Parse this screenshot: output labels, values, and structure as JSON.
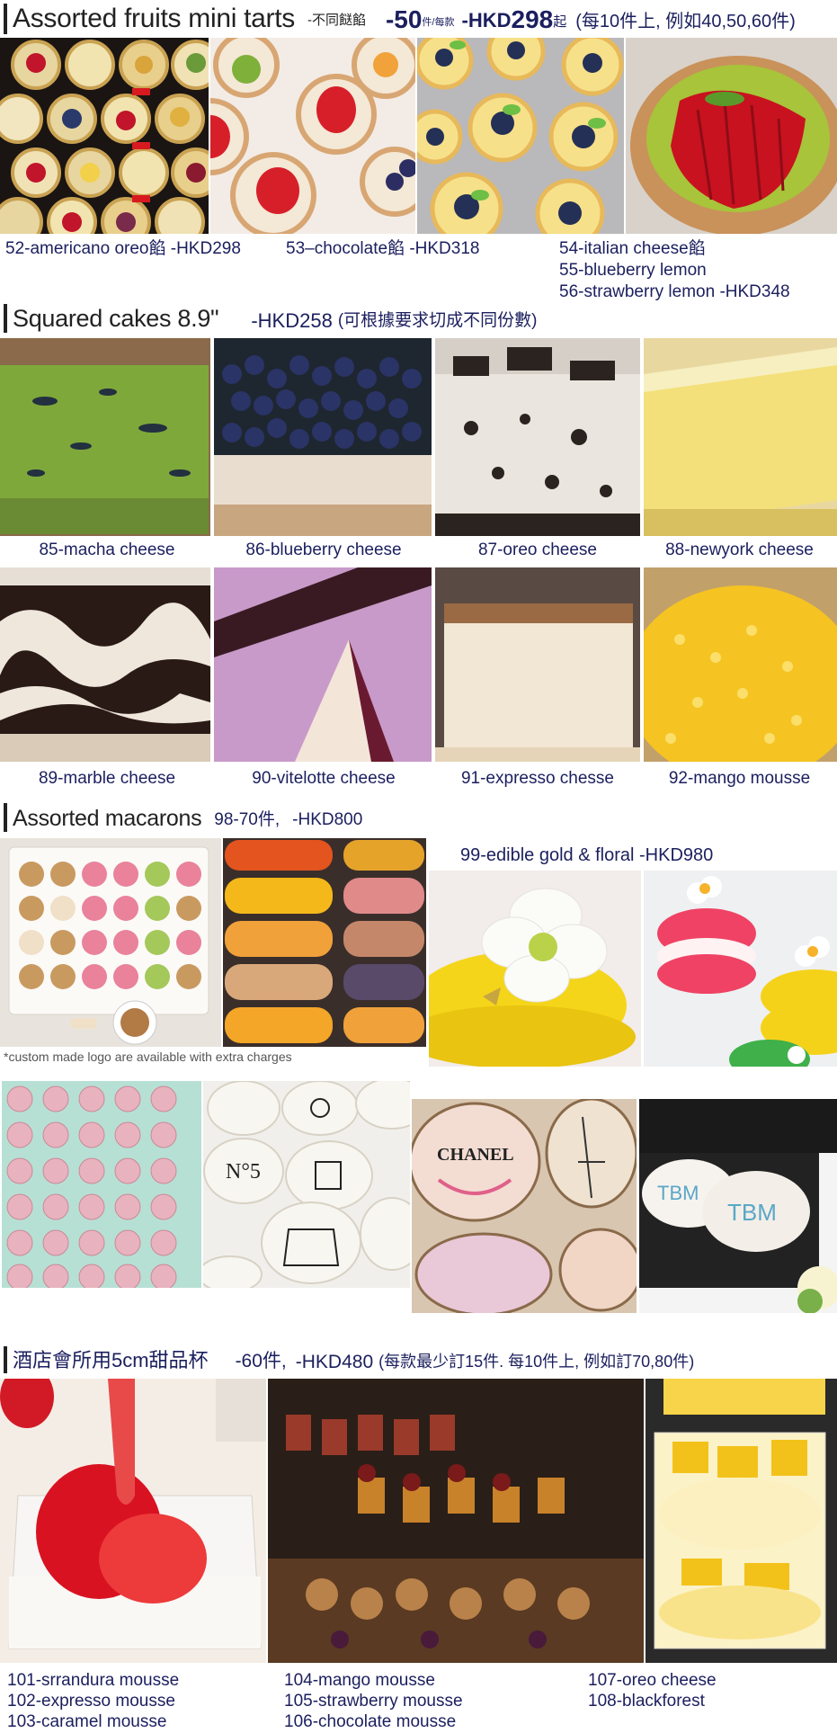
{
  "tarts": {
    "title": "Assorted fruits mini tarts",
    "note": "-不同餸餡",
    "qty": "-50",
    "qty_unit": "件/每款",
    "price_pre": "-HKD",
    "price": "298",
    "price_post": "起",
    "extra": "(每10件上, 例如40,50,60件)",
    "cap1": "52-americano oreo餡 -HKD298",
    "cap2": "53–chocolate餡 -HKD318",
    "cap3a": "54-italian cheese餡",
    "cap3b": "55-blueberry lemon",
    "cap3c": "56-strawberry lemon -HKD348"
  },
  "squared": {
    "title": "Squared cakes 8.9\"",
    "price": "-HKD258",
    "note": "(可根據要求切成不同份數)",
    "items": [
      "85-macha cheese",
      "86-blueberry cheese",
      "87-oreo cheese",
      "88-newyork cheese",
      "89-marble cheese",
      "90-vitelotte cheese",
      "91-expresso chesse",
      "92-mango mousse"
    ]
  },
  "macarons": {
    "title": "Assorted macarons",
    "qty": "98-70件,",
    "price": "-HKD800",
    "gold": "99-edible gold & floral -HKD980",
    "custom": "*custom made logo are available with extra charges"
  },
  "cups": {
    "title": "酒店會所用5cm甜品杯",
    "qty": "-60件,",
    "price": "-HKD480",
    "note": "(每款最少訂15件. 每10件上, 例如訂70,80件)",
    "col1": [
      "101-srrandura mousse",
      "102-expresso mousse",
      "103-caramel mousse"
    ],
    "col2": [
      "104-mango mousse",
      "105-strawberry mousse",
      "106-chocolate mousse"
    ],
    "col3": [
      "107-oreo cheese",
      "108-blackforest"
    ]
  },
  "photos": {
    "p1": "Mini fruit tarts on dark tray",
    "p2": "Strawberry kiwi tarts"
  }
}
